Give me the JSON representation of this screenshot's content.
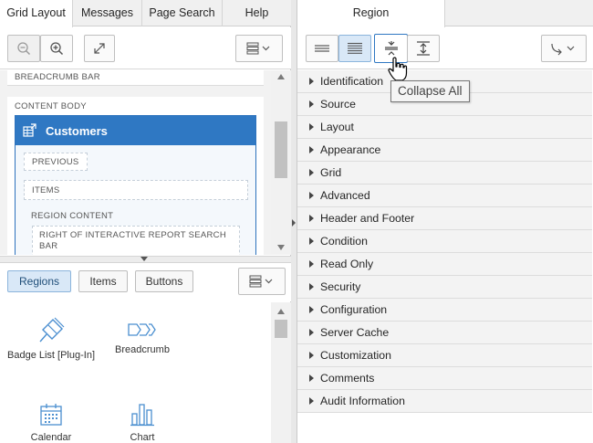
{
  "left_tabs": [
    "Grid Layout",
    "Messages",
    "Page Search",
    "Help"
  ],
  "canvas": {
    "breadcrumb_bar": "BREADCRUMB BAR",
    "content_body": "CONTENT BODY",
    "region_title": "Customers",
    "previous": "PREVIOUS",
    "items": "ITEMS",
    "region_content": "REGION CONTENT",
    "right_of_search_bar": "RIGHT OF INTERACTIVE REPORT SEARCH BAR"
  },
  "gallery_tabs": [
    "Regions",
    "Items",
    "Buttons"
  ],
  "gallery_items": [
    "Badge List [Plug-In]",
    "Breadcrumb",
    "Calendar",
    "Chart"
  ],
  "right_tab": "Region",
  "tooltip": "Collapse All",
  "property_groups": [
    "Identification",
    "Source",
    "Layout",
    "Appearance",
    "Grid",
    "Advanced",
    "Header and Footer",
    "Condition",
    "Read Only",
    "Security",
    "Configuration",
    "Server Cache",
    "Customization",
    "Comments",
    "Audit Information"
  ],
  "icons": {
    "zoom_out": "zoom-out-icon",
    "zoom_in": "zoom-in-icon",
    "expand": "expand-icon",
    "menu": "menu-icon",
    "region": "region-grid-icon",
    "badge": "badge-list-icon",
    "breadcrumb": "breadcrumb-icon",
    "calendar": "calendar-icon",
    "chart": "chart-icon",
    "go_to": "go-to-group-icon",
    "hand": "hand-pointer-icon"
  },
  "colors": {
    "accent": "#2f78c3",
    "active_seg": "#d9e8f7",
    "panel": "#f3f3f3"
  }
}
